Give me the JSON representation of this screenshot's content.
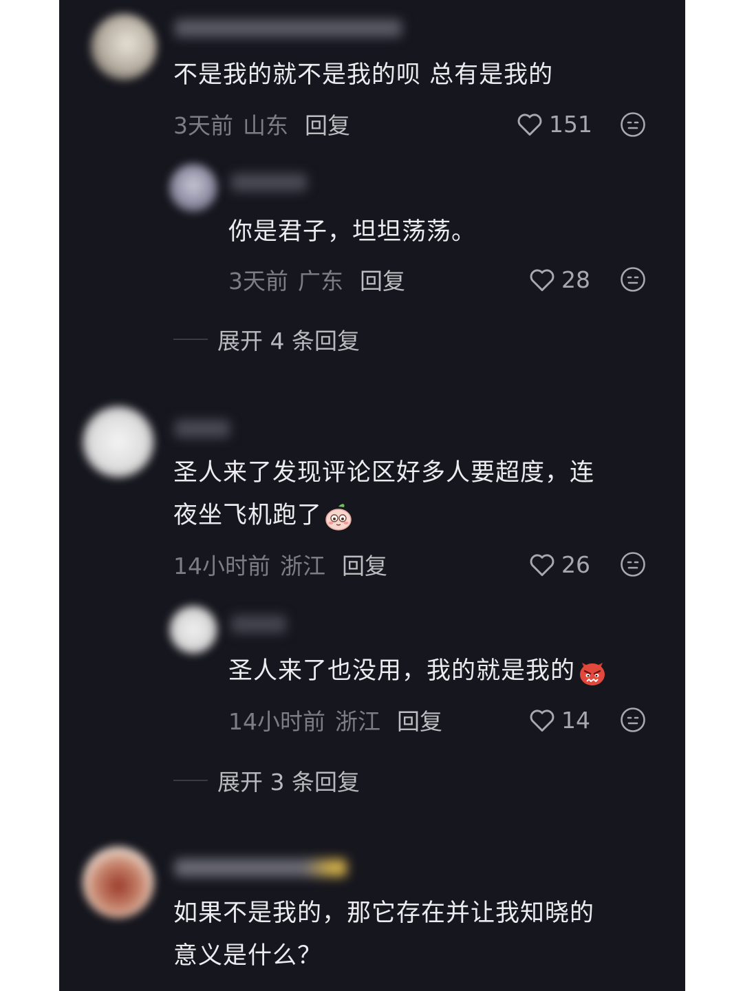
{
  "comments": [
    {
      "text": "不是我的就不是我的呗 总有是我的",
      "time": "3天前",
      "location": "山东",
      "reply_label": "回复",
      "likes": "151"
    },
    {
      "text": "你是君子，坦坦荡荡。",
      "time": "3天前",
      "location": "广东",
      "reply_label": "回复",
      "likes": "28"
    },
    {
      "line1": "圣人来了发现评论区好多人要超度，连",
      "line2": "夜坐飞机跑了",
      "emoji": "shy-peach-emoji",
      "time": "14小时前",
      "location": "浙江",
      "reply_label": "回复",
      "likes": "26"
    },
    {
      "text": "圣人来了也没用，我的就是我的",
      "emoji": "angry-devil-emoji",
      "time": "14小时前",
      "location": "浙江",
      "reply_label": "回复",
      "likes": "14"
    },
    {
      "line1": "如果不是我的，那它存在并让我知晓的",
      "line2": "意义是什么？"
    }
  ],
  "expand_1": "展开 4 条回复",
  "expand_2": "展开 3 条回复",
  "colors": {
    "background": "#16161e",
    "text": "#ececf0",
    "meta": "#7d7d85"
  }
}
